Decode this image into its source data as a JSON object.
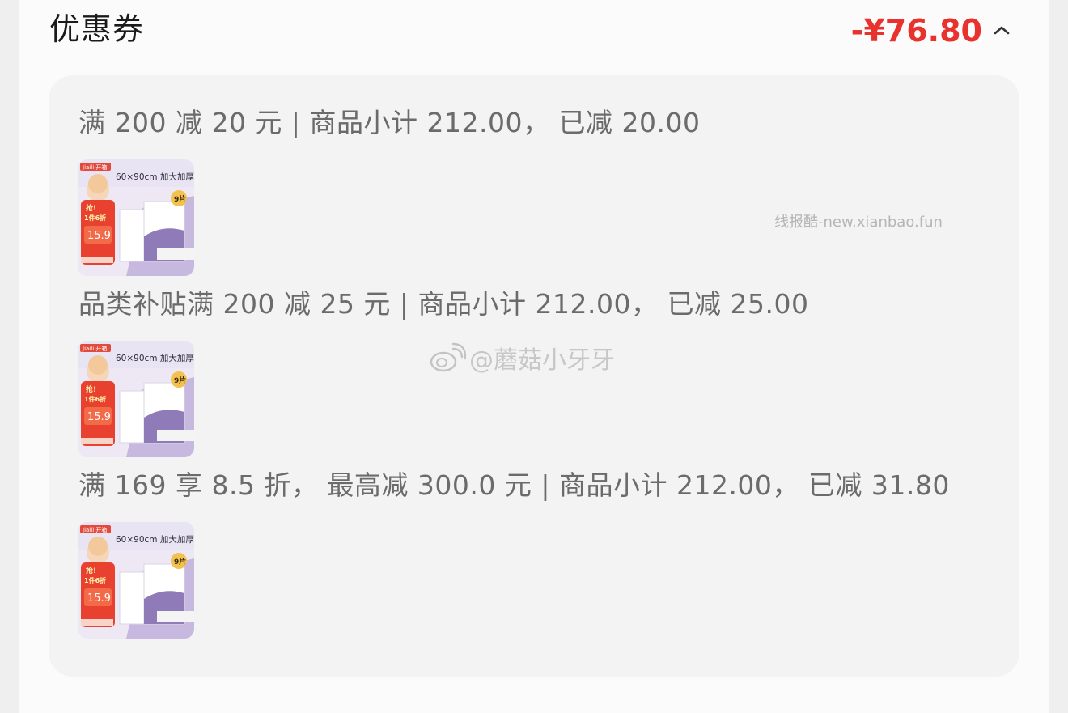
{
  "header": {
    "title": "优惠券",
    "amount": "-¥76.80",
    "toggle_icon": "chevron-up-icon"
  },
  "coupons": [
    {
      "rule": "满 200 减 20 元 | 商品小计 212.00， 已减 20.00",
      "product": {
        "badge": "Jiaili 开箱",
        "headline": "60×90cm 加大加厚",
        "promo": "抢!",
        "promo_sub": "1件6折",
        "price": "15.9",
        "count": "9片"
      }
    },
    {
      "rule": "品类补贴满 200 减 25 元 | 商品小计 212.00， 已减 25.00",
      "product": {
        "badge": "Jiaili 开箱",
        "headline": "60×90cm 加大加厚",
        "promo": "抢!",
        "promo_sub": "1件6折",
        "price": "15.9",
        "count": "9片"
      }
    },
    {
      "rule": "满 169 享 8.5 折， 最高减 300.0 元 | 商品小计 212.00， 已减 31.80",
      "product": {
        "badge": "Jiaili 开箱",
        "headline": "60×90cm 加大加厚",
        "promo": "抢!",
        "promo_sub": "1件6折",
        "price": "15.9",
        "count": "9片"
      }
    }
  ],
  "watermarks": {
    "site": "线报酷-new.xianbao.fun",
    "weibo": "@蘑菇小牙牙"
  },
  "colors": {
    "accent_red": "#e8322d",
    "card_bg": "#f3f3f3",
    "panel_bg": "#fbfbfb",
    "rule_text": "#6b6b6b"
  }
}
